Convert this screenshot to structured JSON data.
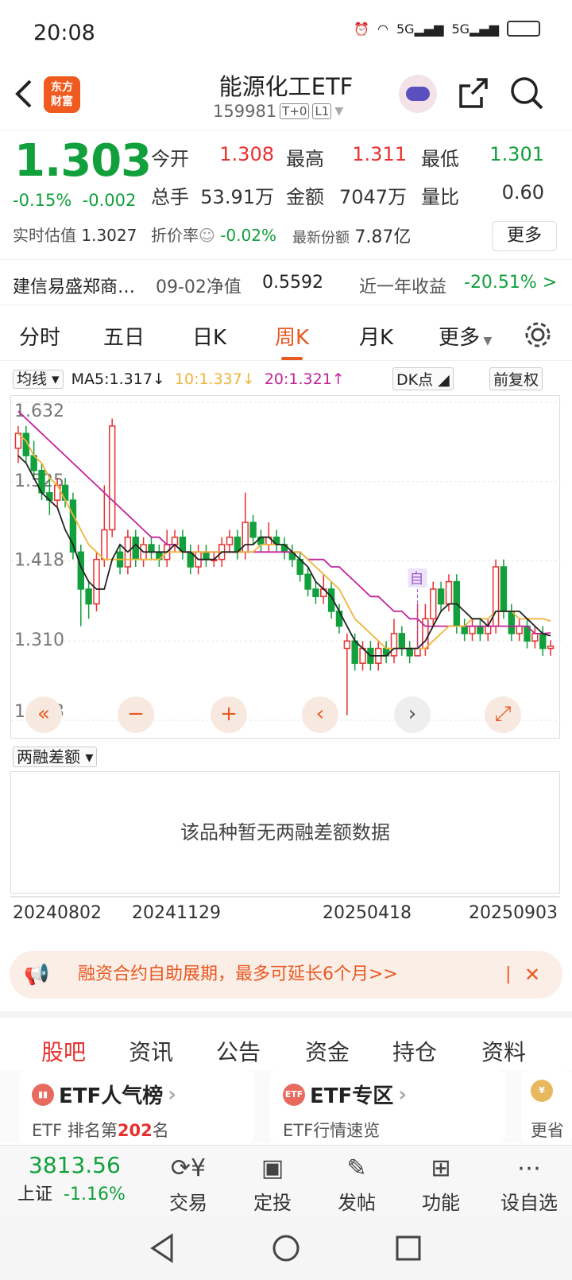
{
  "status": {
    "time": "20:08",
    "net1": "5G",
    "net2": "5G"
  },
  "header": {
    "logo_line1": "东方",
    "logo_line2": "财富",
    "title": "能源化工ETF",
    "code": "159981",
    "tag1": "T+0",
    "tag2": "L1"
  },
  "quote": {
    "price": "1.303",
    "change_pct": "-0.15%",
    "change": "-0.002",
    "open_label": "今开",
    "open": "1.308",
    "high_label": "最高",
    "high": "1.311",
    "low_label": "最低",
    "low": "1.301",
    "vol_label": "总手",
    "vol": "53.91万",
    "amt_label": "金额",
    "amt": "7047万",
    "ratio_label": "量比",
    "ratio": "0.60",
    "est_label": "实时估值",
    "est": "1.3027",
    "disc_label": "折价率",
    "disc": "-0.02%",
    "shares_label": "最新份额",
    "shares": "7.87亿",
    "more": "更多"
  },
  "fund": {
    "name": "建信易盛郑商…",
    "nav_label": "09-02净值",
    "nav": "0.5592",
    "year_label": "近一年收益",
    "year": "-20.51% >"
  },
  "tabs": [
    "分时",
    "五日",
    "日K",
    "周K",
    "月K",
    "更多"
  ],
  "ma": {
    "select": "均线",
    "ma5": "MA5:1.317↓",
    "ma10": "10:1.337↓",
    "ma20": "20:1.321↑",
    "dk": "DK点",
    "adj": "前复权"
  },
  "chart_data": {
    "type": "candlestick",
    "y_ticks": [
      "1.632",
      "1.525",
      "1.418",
      "1.310",
      "1.203"
    ],
    "ylim": [
      1.203,
      1.632
    ],
    "marker": "自",
    "x_labels": [
      "20240802",
      "20241129",
      "20250418",
      "20250903"
    ],
    "candles": [
      [
        1.57,
        1.59,
        1.6,
        1.55
      ],
      [
        1.59,
        1.56,
        1.6,
        1.55
      ],
      [
        1.56,
        1.54,
        1.58,
        1.53
      ],
      [
        1.54,
        1.51,
        1.55,
        1.5
      ],
      [
        1.51,
        1.5,
        1.53,
        1.48
      ],
      [
        1.5,
        1.52,
        1.53,
        1.49
      ],
      [
        1.52,
        1.5,
        1.53,
        1.49
      ],
      [
        1.5,
        1.43,
        1.51,
        1.42
      ],
      [
        1.43,
        1.38,
        1.44,
        1.33
      ],
      [
        1.38,
        1.36,
        1.39,
        1.34
      ],
      [
        1.36,
        1.42,
        1.43,
        1.35
      ],
      [
        1.42,
        1.46,
        1.52,
        1.41
      ],
      [
        1.46,
        1.6,
        1.61,
        1.45
      ],
      [
        1.43,
        1.41,
        1.44,
        1.4
      ],
      [
        1.41,
        1.45,
        1.46,
        1.4
      ],
      [
        1.45,
        1.42,
        1.46,
        1.41
      ],
      [
        1.42,
        1.44,
        1.45,
        1.41
      ],
      [
        1.44,
        1.43,
        1.45,
        1.42
      ],
      [
        1.43,
        1.42,
        1.44,
        1.41
      ],
      [
        1.42,
        1.44,
        1.46,
        1.41
      ],
      [
        1.44,
        1.45,
        1.46,
        1.43
      ],
      [
        1.45,
        1.43,
        1.46,
        1.42
      ],
      [
        1.43,
        1.41,
        1.44,
        1.4
      ],
      [
        1.41,
        1.43,
        1.44,
        1.4
      ],
      [
        1.43,
        1.42,
        1.44,
        1.41
      ],
      [
        1.42,
        1.42,
        1.43,
        1.41
      ],
      [
        1.42,
        1.44,
        1.45,
        1.41
      ],
      [
        1.44,
        1.45,
        1.46,
        1.43
      ],
      [
        1.45,
        1.43,
        1.46,
        1.42
      ],
      [
        1.43,
        1.47,
        1.51,
        1.42
      ],
      [
        1.47,
        1.45,
        1.48,
        1.44
      ],
      [
        1.45,
        1.44,
        1.46,
        1.43
      ],
      [
        1.44,
        1.45,
        1.47,
        1.43
      ],
      [
        1.45,
        1.44,
        1.46,
        1.43
      ],
      [
        1.44,
        1.43,
        1.45,
        1.42
      ],
      [
        1.43,
        1.42,
        1.44,
        1.41
      ],
      [
        1.42,
        1.4,
        1.43,
        1.39
      ],
      [
        1.4,
        1.38,
        1.41,
        1.37
      ],
      [
        1.38,
        1.37,
        1.39,
        1.36
      ],
      [
        1.37,
        1.38,
        1.4,
        1.36
      ],
      [
        1.38,
        1.35,
        1.39,
        1.34
      ],
      [
        1.35,
        1.33,
        1.36,
        1.32
      ],
      [
        1.3,
        1.31,
        1.32,
        1.21
      ],
      [
        1.31,
        1.28,
        1.32,
        1.27
      ],
      [
        1.28,
        1.3,
        1.31,
        1.27
      ],
      [
        1.3,
        1.28,
        1.31,
        1.27
      ],
      [
        1.28,
        1.3,
        1.31,
        1.27
      ],
      [
        1.3,
        1.29,
        1.31,
        1.28
      ],
      [
        1.29,
        1.32,
        1.34,
        1.28
      ],
      [
        1.32,
        1.3,
        1.33,
        1.29
      ],
      [
        1.3,
        1.29,
        1.31,
        1.28
      ],
      [
        1.29,
        1.3,
        1.36,
        1.29
      ],
      [
        1.3,
        1.34,
        1.36,
        1.29
      ],
      [
        1.34,
        1.38,
        1.39,
        1.33
      ],
      [
        1.38,
        1.36,
        1.39,
        1.35
      ],
      [
        1.36,
        1.39,
        1.4,
        1.35
      ],
      [
        1.39,
        1.33,
        1.4,
        1.32
      ],
      [
        1.33,
        1.32,
        1.34,
        1.31
      ],
      [
        1.32,
        1.33,
        1.34,
        1.31
      ],
      [
        1.33,
        1.32,
        1.34,
        1.31
      ],
      [
        1.32,
        1.33,
        1.34,
        1.31
      ],
      [
        1.33,
        1.41,
        1.42,
        1.32
      ],
      [
        1.41,
        1.35,
        1.42,
        1.34
      ],
      [
        1.35,
        1.32,
        1.36,
        1.31
      ],
      [
        1.32,
        1.33,
        1.34,
        1.31
      ],
      [
        1.33,
        1.31,
        1.34,
        1.3
      ],
      [
        1.31,
        1.32,
        1.33,
        1.3
      ],
      [
        1.32,
        1.3,
        1.33,
        1.29
      ],
      [
        1.3,
        1.303,
        1.311,
        1.29
      ]
    ],
    "ma5": [
      1.56,
      1.55,
      1.53,
      1.51,
      1.5,
      1.49,
      1.46,
      1.44,
      1.41,
      1.39,
      1.38,
      1.38,
      1.42,
      1.44,
      1.43,
      1.44,
      1.43,
      1.43,
      1.43,
      1.43,
      1.44,
      1.43,
      1.43,
      1.42,
      1.42,
      1.42,
      1.43,
      1.43,
      1.43,
      1.44,
      1.44,
      1.45,
      1.45,
      1.44,
      1.44,
      1.43,
      1.42,
      1.41,
      1.39,
      1.38,
      1.37,
      1.35,
      1.33,
      1.31,
      1.3,
      1.29,
      1.29,
      1.29,
      1.3,
      1.3,
      1.3,
      1.3,
      1.31,
      1.33,
      1.35,
      1.36,
      1.36,
      1.35,
      1.34,
      1.34,
      1.33,
      1.35,
      1.35,
      1.35,
      1.35,
      1.34,
      1.33,
      1.32,
      1.317
    ],
    "ma10": [
      1.59,
      1.58,
      1.56,
      1.55,
      1.53,
      1.52,
      1.5,
      1.48,
      1.46,
      1.44,
      1.43,
      1.42,
      1.42,
      1.42,
      1.42,
      1.42,
      1.42,
      1.42,
      1.42,
      1.43,
      1.43,
      1.43,
      1.43,
      1.43,
      1.43,
      1.43,
      1.43,
      1.43,
      1.43,
      1.43,
      1.43,
      1.44,
      1.44,
      1.44,
      1.44,
      1.43,
      1.43,
      1.42,
      1.41,
      1.4,
      1.39,
      1.38,
      1.36,
      1.34,
      1.33,
      1.32,
      1.31,
      1.3,
      1.3,
      1.3,
      1.3,
      1.3,
      1.3,
      1.31,
      1.32,
      1.33,
      1.33,
      1.33,
      1.34,
      1.34,
      1.34,
      1.35,
      1.35,
      1.35,
      1.34,
      1.34,
      1.34,
      1.34,
      1.337
    ],
    "ma20": [
      1.62,
      1.61,
      1.6,
      1.59,
      1.58,
      1.57,
      1.56,
      1.55,
      1.54,
      1.53,
      1.52,
      1.51,
      1.5,
      1.49,
      1.48,
      1.47,
      1.46,
      1.45,
      1.45,
      1.44,
      1.44,
      1.43,
      1.43,
      1.43,
      1.43,
      1.43,
      1.43,
      1.43,
      1.43,
      1.43,
      1.43,
      1.43,
      1.43,
      1.43,
      1.43,
      1.43,
      1.43,
      1.42,
      1.42,
      1.42,
      1.41,
      1.41,
      1.4,
      1.39,
      1.38,
      1.37,
      1.37,
      1.36,
      1.35,
      1.35,
      1.34,
      1.34,
      1.33,
      1.33,
      1.33,
      1.33,
      1.33,
      1.33,
      1.33,
      1.33,
      1.33,
      1.33,
      1.33,
      1.33,
      1.33,
      1.33,
      1.32,
      1.32,
      1.321
    ]
  },
  "colors": {
    "up": "#e8302f",
    "down": "#12a03c",
    "ma5": "#222222",
    "ma10": "#f0b43c",
    "ma20": "#c3239b",
    "accent": "#e8581f"
  },
  "controls": [
    "«",
    "−",
    "+",
    "‹",
    "›",
    "⤢"
  ],
  "margin": {
    "select": "两融差额",
    "empty": "该品种暂无两融差额数据"
  },
  "banner": {
    "text": "融资合约自助展期，最多可延长6个月>>",
    "close": "✕"
  },
  "subtabs": [
    "股吧",
    "资讯",
    "公告",
    "资金",
    "持仓",
    "资料"
  ],
  "cards": [
    {
      "title": "ETF人气榜",
      "pre": "ETF 排名第",
      "rank": "202",
      "post": "名",
      "icon": "chart-icon"
    },
    {
      "title": "ETF专区",
      "sub": "ETF行情速览",
      "icon": "etf-icon"
    },
    {
      "sub": "更省"
    }
  ],
  "bottom": {
    "index_value": "3813.56",
    "index_name": "上证",
    "index_change": "-1.16%",
    "items": [
      "交易",
      "定投",
      "发帖",
      "功能",
      "设自选"
    ]
  }
}
